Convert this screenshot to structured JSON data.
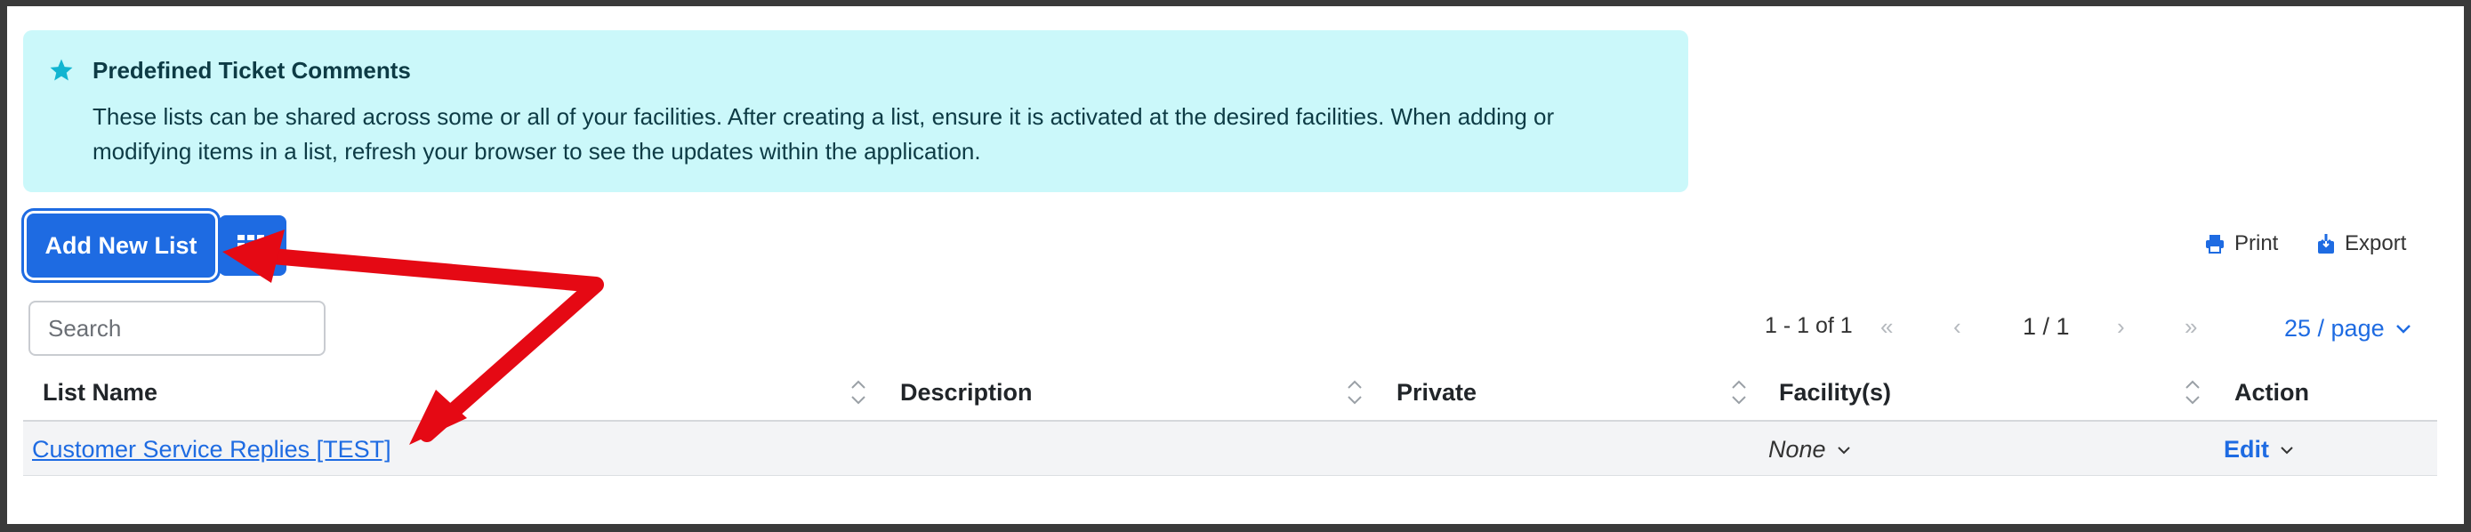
{
  "info": {
    "title": "Predefined Ticket Comments",
    "body": "These lists can be shared across some or all of your facilities. After creating a list, ensure it is activated at the desired facilities. When adding or modifying items in a list, refresh your browser to see the updates within the application.",
    "icon": "star-icon",
    "color": "#cbf8fa"
  },
  "toolbar": {
    "add_label": "Add New List",
    "grid_icon": "grid-icon",
    "print_label": "Print",
    "export_label": "Export"
  },
  "search": {
    "placeholder": "Search"
  },
  "pagination": {
    "range": "1 - 1 of 1",
    "page": "1 / 1",
    "page_size": "25 / page"
  },
  "table": {
    "columns": [
      "List Name",
      "Description",
      "Private",
      "Facility(s)",
      "Action"
    ],
    "rows": [
      {
        "list_name": "Customer Service Replies [TEST]",
        "description": "",
        "private": "",
        "facility": "None",
        "action": "Edit"
      }
    ]
  },
  "colors": {
    "accent": "#1e6be2",
    "annotation": "#e50914"
  }
}
